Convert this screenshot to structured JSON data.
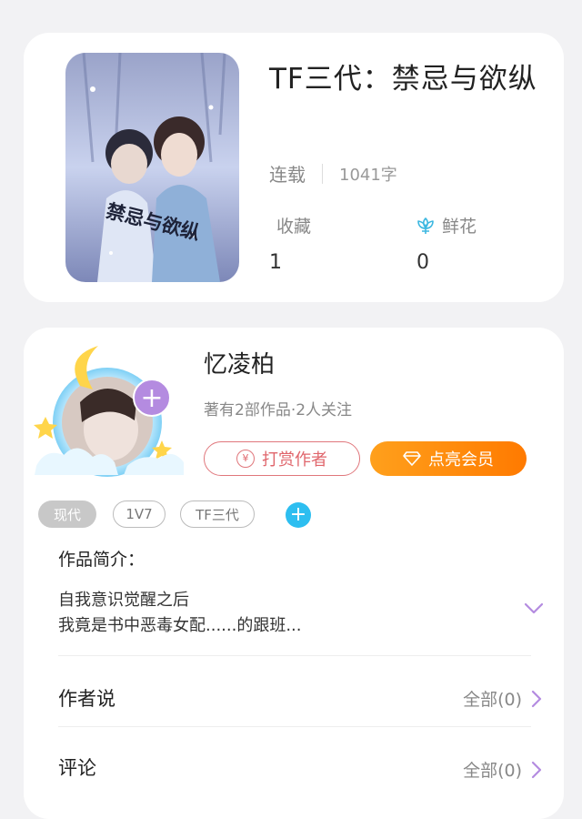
{
  "book": {
    "title": "TF三代：禁忌与欲纵",
    "status": "连载",
    "word_count": "1041字",
    "cover_text": "禁忌与欲纵",
    "favorites_label": "收藏",
    "favorites_value": "1",
    "flowers_label": "鲜花",
    "flowers_value": "0"
  },
  "author": {
    "name": "忆凌柏",
    "summary": "著有2部作品·2人关注",
    "tip_button": "打赏作者",
    "vip_button": "点亮会员",
    "follow_symbol": "+"
  },
  "tags": [
    "现代",
    "1V7",
    "TF三代"
  ],
  "tag_add_symbol": "+",
  "intro": {
    "title": "作品简介：",
    "line1": "自我意识觉醒之后",
    "line2": "我竟是书中恶毒女配......的跟班..."
  },
  "author_says": {
    "label": "作者说",
    "right": "全部(0)"
  },
  "comments": {
    "label": "评论",
    "right": "全部(0)"
  },
  "colors": {
    "accent_purple": "#b48be0",
    "tip_red": "#e0666c",
    "vip_orange": "#ff8a00",
    "tag_add_blue": "#2dbef0"
  }
}
